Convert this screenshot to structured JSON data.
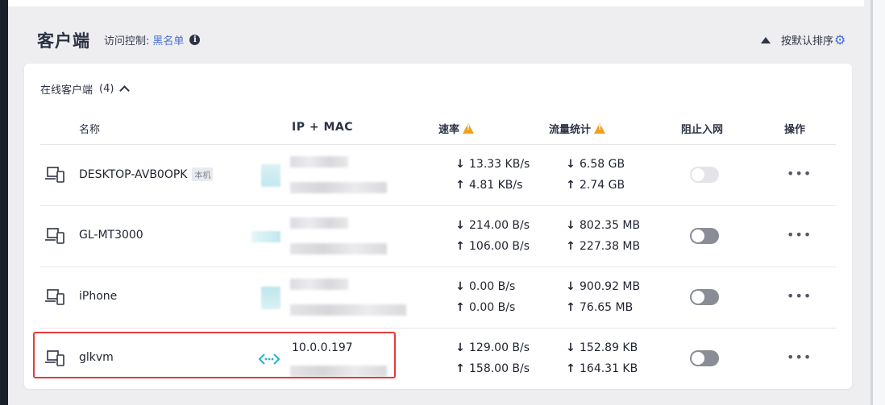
{
  "header": {
    "title": "客户端",
    "access_label": "访问控制:",
    "access_value": "黑名单",
    "sort_label": "按默认排序",
    "icons": [
      "info-icon",
      "triangle-up-icon",
      "gear-icon"
    ]
  },
  "list": {
    "online_label": "在线客户端",
    "online_count": "(4)",
    "columns": {
      "name": "名称",
      "ip_mac": "IP + MAC",
      "rate": "速率",
      "traffic": "流量统计",
      "block": "阻止入网",
      "ops": "操作"
    },
    "rows": [
      {
        "name": "DESKTOP-AVB0OPK",
        "badge": "本机",
        "ip": "",
        "rate_down": "13.33 KB/s",
        "rate_up": "4.81 KB/s",
        "traffic_down": "6.58 GB",
        "traffic_up": "2.74 GB",
        "blocked": false,
        "toggle_disabled": true
      },
      {
        "name": "GL-MT3000",
        "badge": "",
        "ip": "",
        "rate_down": "214.00 B/s",
        "rate_up": "106.00 B/s",
        "traffic_down": "802.35 MB",
        "traffic_up": "227.38 MB",
        "blocked": false,
        "toggle_disabled": false
      },
      {
        "name": "iPhone",
        "badge": "",
        "ip": "",
        "rate_down": "0.00 B/s",
        "rate_up": "0.00 B/s",
        "traffic_down": "900.92 MB",
        "traffic_up": "76.65 MB",
        "blocked": false,
        "toggle_disabled": false
      },
      {
        "name": "glkvm",
        "badge": "",
        "ip": "10.0.0.197",
        "rate_down": "129.00 B/s",
        "rate_up": "158.00 B/s",
        "traffic_down": "152.89 KB",
        "traffic_up": "164.31 KB",
        "blocked": false,
        "toggle_disabled": false
      }
    ],
    "more_glyph": "•••",
    "down_arrow": "↓",
    "up_arrow": "↑"
  },
  "colors": {
    "accent": "#4b6fd6",
    "warning": "#f0a020",
    "highlight": "#e53a3a",
    "connection": "#1fb5c9"
  }
}
